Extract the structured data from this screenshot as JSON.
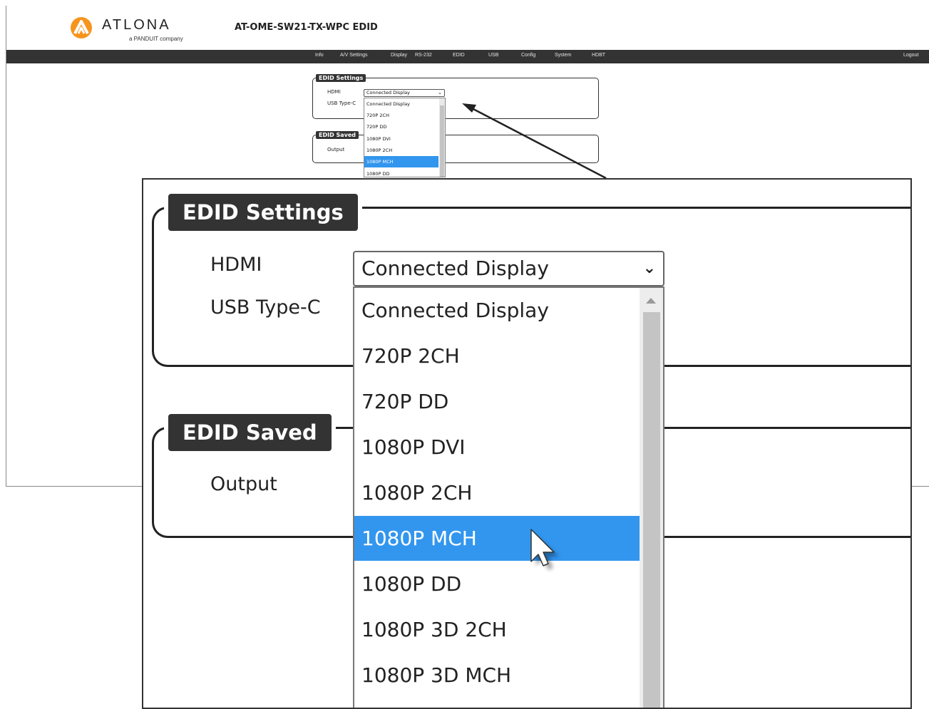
{
  "header": {
    "logo_text": "ATLONA",
    "logo_subtext": "a PANDUIT company",
    "device_title": "AT-OME-SW21-TX-WPC  EDID"
  },
  "nav": {
    "items": [
      "Info",
      "A/V Settings",
      "Display",
      "RS-232",
      "EDID",
      "USB",
      "Config",
      "System",
      "HDBT"
    ],
    "logout": "Logout"
  },
  "edid_settings": {
    "legend": "EDID Settings",
    "hdmi_label": "HDMI",
    "usb_label": "USB Type-C",
    "hdmi_selected": "Connected Display",
    "options": [
      "Connected Display",
      "720P 2CH",
      "720P DD",
      "1080P DVI",
      "1080P 2CH",
      "1080P MCH",
      "1080P DD",
      "1080P 3D 2CH",
      "1080P 3D MCH"
    ],
    "highlighted": "1080P MCH"
  },
  "edid_saved": {
    "legend": "EDID Saved",
    "output_label": "Output"
  },
  "colors": {
    "nav_bg": "#333333",
    "highlight": "#3296ee",
    "logo_orange": "#f7941d"
  }
}
